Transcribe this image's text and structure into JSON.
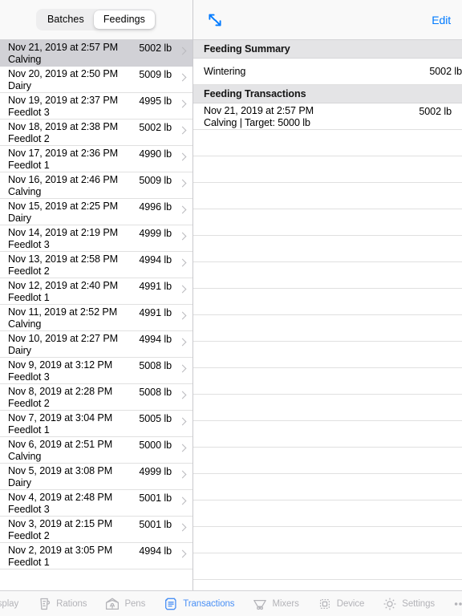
{
  "master": {
    "segmented_control": {
      "name": "batches-feedings-selector",
      "options": [
        "Batches",
        "Feedings"
      ],
      "selected": "Feedings"
    },
    "rows": [
      {
        "date": "Nov 21, 2019 at 2:57 PM",
        "pen": "Calving",
        "amount": "5002 lb",
        "selected": true
      },
      {
        "date": "Nov 20, 2019 at 2:50 PM",
        "pen": "Dairy",
        "amount": "5009 lb",
        "selected": false
      },
      {
        "date": "Nov 19, 2019 at 2:37 PM",
        "pen": "Feedlot 3",
        "amount": "4995 lb",
        "selected": false
      },
      {
        "date": "Nov 18, 2019 at 2:38 PM",
        "pen": "Feedlot 2",
        "amount": "5002 lb",
        "selected": false
      },
      {
        "date": "Nov 17, 2019 at 2:36 PM",
        "pen": "Feedlot 1",
        "amount": "4990 lb",
        "selected": false
      },
      {
        "date": "Nov 16, 2019 at 2:46 PM",
        "pen": "Calving",
        "amount": "5009 lb",
        "selected": false
      },
      {
        "date": "Nov 15, 2019 at 2:25 PM",
        "pen": "Dairy",
        "amount": "4996 lb",
        "selected": false
      },
      {
        "date": "Nov 14, 2019 at 2:19 PM",
        "pen": "Feedlot 3",
        "amount": "4999 lb",
        "selected": false
      },
      {
        "date": "Nov 13, 2019 at 2:58 PM",
        "pen": "Feedlot 2",
        "amount": "4994 lb",
        "selected": false
      },
      {
        "date": "Nov 12, 2019 at 2:40 PM",
        "pen": "Feedlot 1",
        "amount": "4991 lb",
        "selected": false
      },
      {
        "date": "Nov 11, 2019 at 2:52 PM",
        "pen": "Calving",
        "amount": "4991 lb",
        "selected": false
      },
      {
        "date": "Nov 10, 2019 at 2:27 PM",
        "pen": "Dairy",
        "amount": "4994 lb",
        "selected": false
      },
      {
        "date": "Nov 9, 2019 at 3:12 PM",
        "pen": "Feedlot 3",
        "amount": "5008 lb",
        "selected": false
      },
      {
        "date": "Nov 8, 2019 at 2:28 PM",
        "pen": "Feedlot 2",
        "amount": "5008 lb",
        "selected": false
      },
      {
        "date": "Nov 7, 2019 at 3:04 PM",
        "pen": "Feedlot 1",
        "amount": "5005 lb",
        "selected": false
      },
      {
        "date": "Nov 6, 2019 at 2:51 PM",
        "pen": "Calving",
        "amount": "5000 lb",
        "selected": false
      },
      {
        "date": "Nov 5, 2019 at 3:08 PM",
        "pen": "Dairy",
        "amount": "4999 lb",
        "selected": false
      },
      {
        "date": "Nov 4, 2019 at 2:48 PM",
        "pen": "Feedlot 3",
        "amount": "5001 lb",
        "selected": false
      },
      {
        "date": "Nov 3, 2019 at 2:15 PM",
        "pen": "Feedlot 2",
        "amount": "5001 lb",
        "selected": false
      },
      {
        "date": "Nov 2, 2019 at 3:05 PM",
        "pen": "Feedlot 1",
        "amount": "4994 lb",
        "selected": false
      }
    ]
  },
  "detail": {
    "nav": {
      "expand_icon": "expand-diagonal-arrows-icon",
      "edit_label": "Edit",
      "accent_color": "#007aff"
    },
    "summary_section": {
      "header": "Feeding Summary",
      "rows": [
        {
          "label": "Wintering",
          "amount": "5002 lb"
        }
      ]
    },
    "transactions_section": {
      "header": "Feeding Transactions",
      "rows": [
        {
          "date": "Nov 21, 2019 at 2:57 PM",
          "subtitle": "Calving | Target: 5000 lb",
          "amount": "5002 lb"
        }
      ]
    },
    "empty_row_count": 17
  },
  "tabbar": {
    "active_color": "#4a90f5",
    "inactive_color": "#b3b3b8",
    "items": [
      {
        "label": "Display",
        "icon": "seven-segment-display-icon",
        "active": false
      },
      {
        "label": "Rations",
        "icon": "measuring-cup-icon",
        "active": false
      },
      {
        "label": "Pens",
        "icon": "barn-icon",
        "active": false
      },
      {
        "label": "Transactions",
        "icon": "receipt-document-icon",
        "active": true
      },
      {
        "label": "Mixers",
        "icon": "mixer-hopper-icon",
        "active": false
      },
      {
        "label": "Device",
        "icon": "chip-icon",
        "active": false
      },
      {
        "label": "Settings",
        "icon": "gear-icon",
        "active": false
      },
      {
        "label": "More",
        "icon": "ellipsis-icon",
        "active": false
      }
    ]
  }
}
